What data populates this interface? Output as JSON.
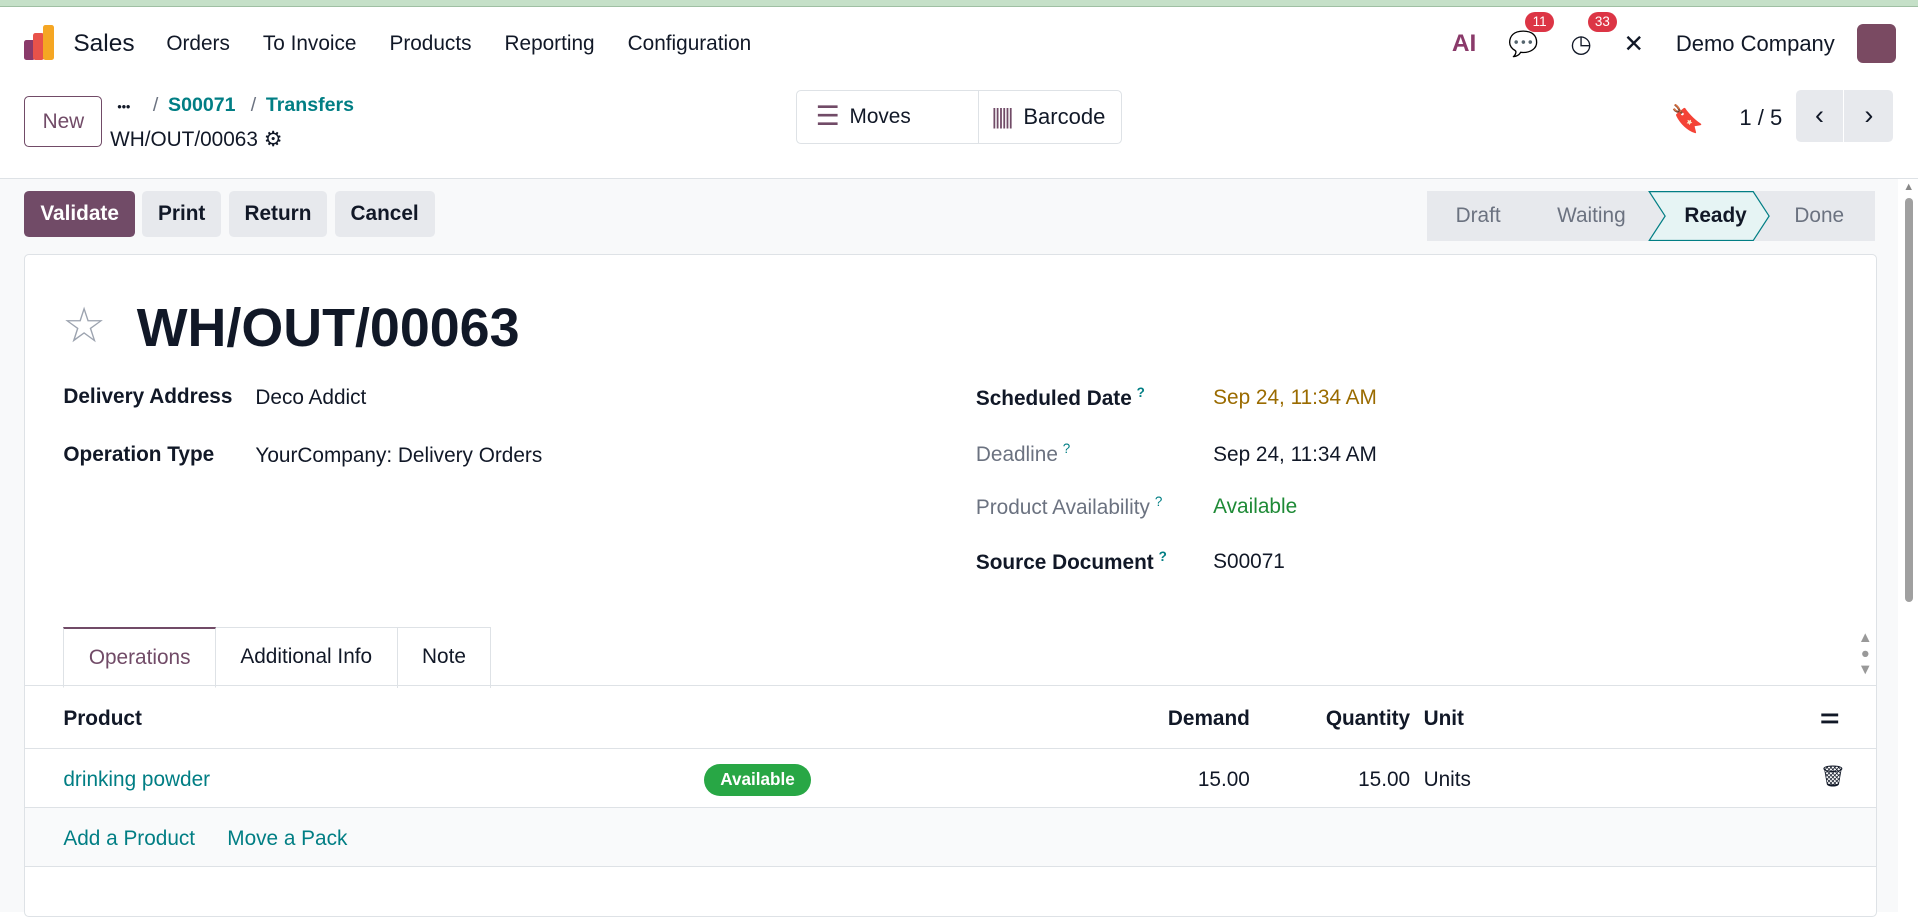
{
  "navbar": {
    "app": "Sales",
    "menu": [
      "Orders",
      "To Invoice",
      "Products",
      "Reporting",
      "Configuration"
    ],
    "ai_label": "AI",
    "messages_count": "11",
    "activities_count": "33",
    "company": "Demo Company"
  },
  "control": {
    "new_label": "New",
    "breadcrumb_more": "•••",
    "breadcrumb": [
      "S00071",
      "Transfers"
    ],
    "record": "WH/OUT/00063",
    "moves_label": "Moves",
    "barcode_label": "Barcode",
    "pager": "1 / 5"
  },
  "actions": [
    "Validate",
    "Print",
    "Return",
    "Cancel"
  ],
  "status": {
    "stages": [
      "Draft",
      "Waiting",
      "Ready",
      "Done"
    ],
    "current": "Ready"
  },
  "form": {
    "title": "WH/OUT/00063",
    "left": [
      {
        "label": "Delivery Address",
        "value": "Deco Addict"
      },
      {
        "label": "Operation Type",
        "value": "YourCompany: Delivery Orders"
      }
    ],
    "right": [
      {
        "label": "Scheduled Date",
        "value": "Sep 24, 11:34 AM"
      },
      {
        "label": "Deadline",
        "value": "Sep 24, 11:34 AM"
      },
      {
        "label": "Product Availability",
        "value": "Available"
      },
      {
        "label": "Source Document",
        "value": "S00071"
      }
    ],
    "help": "?"
  },
  "tabs": [
    "Operations",
    "Additional Info",
    "Note"
  ],
  "table": {
    "headers": [
      "Product",
      "Demand",
      "Quantity",
      "Unit"
    ],
    "rows": [
      {
        "product": "drinking powder",
        "badge": "Available",
        "demand": "15.00",
        "quantity": "15.00",
        "unit": "Units"
      }
    ],
    "add_product": "Add a Product",
    "move_pack": "Move a Pack"
  },
  "colors": {
    "brand": "#714b67",
    "link": "#017e84",
    "warning": "#9a6b00",
    "success": "#28a745"
  }
}
